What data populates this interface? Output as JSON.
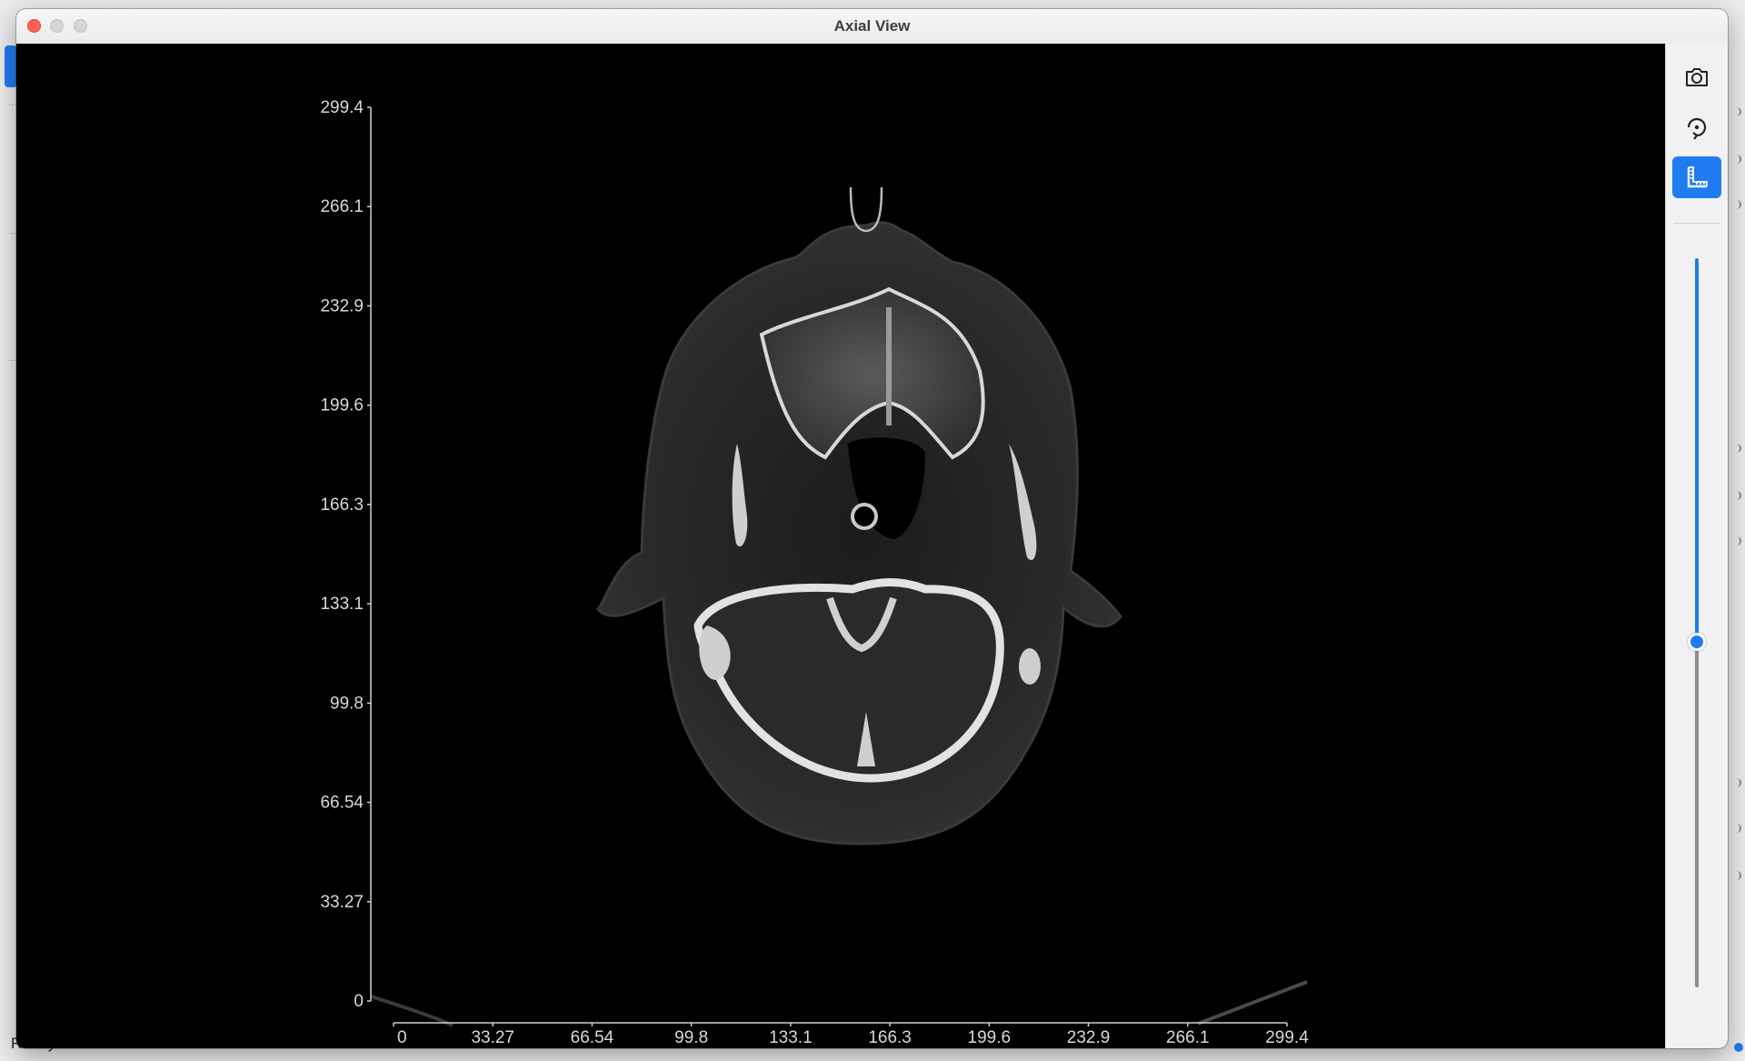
{
  "window": {
    "title": "Axial View"
  },
  "background": {
    "status_text": "Ready"
  },
  "sidebar": {
    "tools": [
      {
        "icon": "camera-icon",
        "label": "Screenshot",
        "active": false
      },
      {
        "icon": "rotate-icon",
        "label": "Rotate",
        "active": false
      },
      {
        "icon": "ruler-icon",
        "label": "Measure",
        "active": true
      }
    ],
    "slice_slider": {
      "value_fraction": 0.53
    }
  },
  "plot": {
    "x_ticks": [
      "0",
      "33.27",
      "66.54",
      "99.8",
      "133.1",
      "166.3",
      "199.6",
      "232.9",
      "266.1",
      "299.4"
    ],
    "y_ticks": [
      "0",
      "33.27",
      "66.54",
      "99.8",
      "133.1",
      "166.3",
      "199.6",
      "232.9",
      "266.1",
      "299.4"
    ]
  },
  "colors": {
    "accent": "#1f7cf0",
    "close": "#fe5f57",
    "bone": "#dcdcdc",
    "tissue": "#2e2e2e"
  }
}
